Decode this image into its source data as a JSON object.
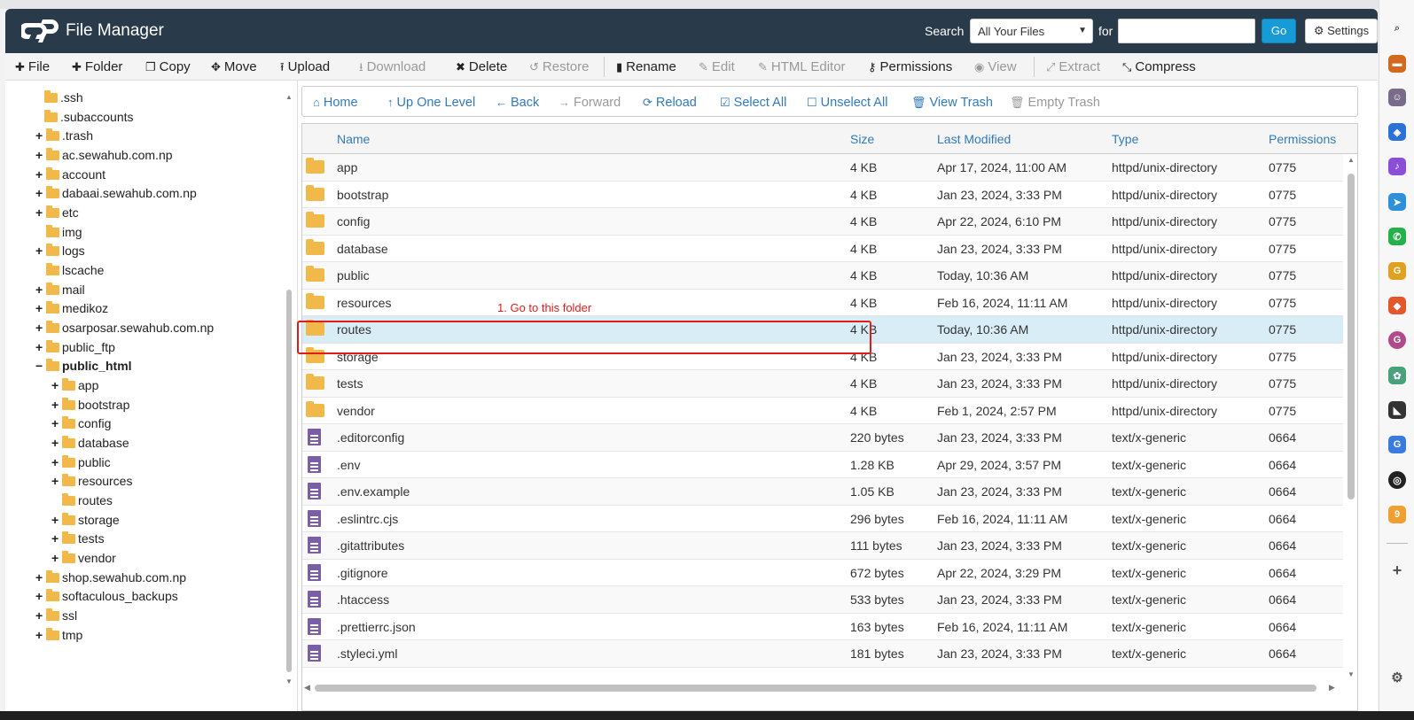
{
  "header": {
    "title": "File Manager",
    "search_label": "Search",
    "search_scope": "All Your Files",
    "for_label": "for",
    "search_value": "",
    "go_label": "Go",
    "settings_label": "Settings"
  },
  "toolbar": {
    "items": [
      {
        "label": "File",
        "icon": "plus-icon",
        "enabled": true
      },
      {
        "label": "Folder",
        "icon": "plus-icon",
        "enabled": true
      },
      {
        "label": "Copy",
        "icon": "copy-icon",
        "enabled": true
      },
      {
        "label": "Move",
        "icon": "move-icon",
        "enabled": true
      },
      {
        "label": "Upload",
        "icon": "upload-icon",
        "enabled": true
      },
      {
        "label": "Download",
        "icon": "download-icon",
        "enabled": false
      },
      {
        "label": "Delete",
        "icon": "x-icon",
        "enabled": true
      },
      {
        "label": "Restore",
        "icon": "restore-icon",
        "enabled": false
      },
      {
        "label": "Rename",
        "icon": "file-icon",
        "enabled": true
      },
      {
        "label": "Edit",
        "icon": "pencil-icon",
        "enabled": false
      },
      {
        "label": "HTML Editor",
        "icon": "edit-icon",
        "enabled": false
      },
      {
        "label": "Permissions",
        "icon": "key-icon",
        "enabled": true
      },
      {
        "label": "View",
        "icon": "eye-icon",
        "enabled": false
      },
      {
        "label": "Extract",
        "icon": "expand-icon",
        "enabled": false
      },
      {
        "label": "Compress",
        "icon": "compress-icon",
        "enabled": true
      }
    ]
  },
  "navbar": {
    "items": [
      {
        "label": "Home",
        "icon": "home-icon",
        "enabled": true
      },
      {
        "label": "Up One Level",
        "icon": "arrow-up-icon",
        "enabled": true
      },
      {
        "label": "Back",
        "icon": "arrow-left-icon",
        "enabled": true
      },
      {
        "label": "Forward",
        "icon": "arrow-right-icon",
        "enabled": false
      },
      {
        "label": "Reload",
        "icon": "refresh-icon",
        "enabled": true
      },
      {
        "label": "Select All",
        "icon": "checkbox-checked-icon",
        "enabled": true
      },
      {
        "label": "Unselect All",
        "icon": "checkbox-empty-icon",
        "enabled": true
      },
      {
        "label": "View Trash",
        "icon": "trash-icon",
        "enabled": true
      },
      {
        "label": "Empty Trash",
        "icon": "trash-icon",
        "enabled": false
      }
    ]
  },
  "tree": {
    "items": [
      {
        "label": ".ssh",
        "expander": ""
      },
      {
        "label": ".subaccounts",
        "expander": ""
      },
      {
        "label": ".trash",
        "expander": "+"
      },
      {
        "label": "ac.sewahub.com.np",
        "expander": "+"
      },
      {
        "label": "account",
        "expander": "+"
      },
      {
        "label": "dabaai.sewahub.com.np",
        "expander": "+"
      },
      {
        "label": "etc",
        "expander": "+"
      },
      {
        "label": "img",
        "expander": ""
      },
      {
        "label": "logs",
        "expander": "+"
      },
      {
        "label": "lscache",
        "expander": ""
      },
      {
        "label": "mail",
        "expander": "+"
      },
      {
        "label": "medikoz",
        "expander": "+"
      },
      {
        "label": "osarposar.sewahub.com.np",
        "expander": "+"
      },
      {
        "label": "public_ftp",
        "expander": "+"
      },
      {
        "label": "public_html",
        "expander": "−"
      },
      {
        "label": "app",
        "expander": "+"
      },
      {
        "label": "bootstrap",
        "expander": "+"
      },
      {
        "label": "config",
        "expander": "+"
      },
      {
        "label": "database",
        "expander": "+"
      },
      {
        "label": "public",
        "expander": "+"
      },
      {
        "label": "resources",
        "expander": "+"
      },
      {
        "label": "routes",
        "expander": ""
      },
      {
        "label": "storage",
        "expander": "+"
      },
      {
        "label": "tests",
        "expander": "+"
      },
      {
        "label": "vendor",
        "expander": "+"
      },
      {
        "label": "shop.sewahub.com.np",
        "expander": "+"
      },
      {
        "label": "softaculous_backups",
        "expander": "+"
      },
      {
        "label": "ssl",
        "expander": "+"
      },
      {
        "label": "tmp",
        "expander": "+"
      }
    ]
  },
  "table": {
    "columns": [
      "Name",
      "Size",
      "Last Modified",
      "Type",
      "Permissions"
    ],
    "rows": [
      {
        "kind": "folder",
        "name": "app",
        "size": "4 KB",
        "modified": "Apr 17, 2024, 11:00 AM",
        "type": "httpd/unix-directory",
        "perms": "0775"
      },
      {
        "kind": "folder",
        "name": "bootstrap",
        "size": "4 KB",
        "modified": "Jan 23, 2024, 3:33 PM",
        "type": "httpd/unix-directory",
        "perms": "0775"
      },
      {
        "kind": "folder",
        "name": "config",
        "size": "4 KB",
        "modified": "Apr 22, 2024, 6:10 PM",
        "type": "httpd/unix-directory",
        "perms": "0775"
      },
      {
        "kind": "folder",
        "name": "database",
        "size": "4 KB",
        "modified": "Jan 23, 2024, 3:33 PM",
        "type": "httpd/unix-directory",
        "perms": "0775"
      },
      {
        "kind": "folder",
        "name": "public",
        "size": "4 KB",
        "modified": "Today, 10:36 AM",
        "type": "httpd/unix-directory",
        "perms": "0775"
      },
      {
        "kind": "folder",
        "name": "resources",
        "size": "4 KB",
        "modified": "Feb 16, 2024, 11:11 AM",
        "type": "httpd/unix-directory",
        "perms": "0775"
      },
      {
        "kind": "folder",
        "name": "routes",
        "size": "4 KB",
        "modified": "Today, 10:36 AM",
        "type": "httpd/unix-directory",
        "perms": "0775",
        "selected": true
      },
      {
        "kind": "folder",
        "name": "storage",
        "size": "4 KB",
        "modified": "Jan 23, 2024, 3:33 PM",
        "type": "httpd/unix-directory",
        "perms": "0775"
      },
      {
        "kind": "folder",
        "name": "tests",
        "size": "4 KB",
        "modified": "Jan 23, 2024, 3:33 PM",
        "type": "httpd/unix-directory",
        "perms": "0775"
      },
      {
        "kind": "folder",
        "name": "vendor",
        "size": "4 KB",
        "modified": "Feb 1, 2024, 2:57 PM",
        "type": "httpd/unix-directory",
        "perms": "0775"
      },
      {
        "kind": "file",
        "name": ".editorconfig",
        "size": "220 bytes",
        "modified": "Jan 23, 2024, 3:33 PM",
        "type": "text/x-generic",
        "perms": "0664"
      },
      {
        "kind": "file",
        "name": ".env",
        "size": "1.28 KB",
        "modified": "Apr 29, 2024, 3:57 PM",
        "type": "text/x-generic",
        "perms": "0664"
      },
      {
        "kind": "file",
        "name": ".env.example",
        "size": "1.05 KB",
        "modified": "Jan 23, 2024, 3:33 PM",
        "type": "text/x-generic",
        "perms": "0664"
      },
      {
        "kind": "file",
        "name": ".eslintrc.cjs",
        "size": "296 bytes",
        "modified": "Feb 16, 2024, 11:11 AM",
        "type": "text/x-generic",
        "perms": "0664"
      },
      {
        "kind": "file",
        "name": ".gitattributes",
        "size": "111 bytes",
        "modified": "Jan 23, 2024, 3:33 PM",
        "type": "text/x-generic",
        "perms": "0664"
      },
      {
        "kind": "file",
        "name": ".gitignore",
        "size": "672 bytes",
        "modified": "Apr 22, 2024, 3:29 PM",
        "type": "text/x-generic",
        "perms": "0664"
      },
      {
        "kind": "file",
        "name": ".htaccess",
        "size": "533 bytes",
        "modified": "Jan 23, 2024, 3:33 PM",
        "type": "text/x-generic",
        "perms": "0664"
      },
      {
        "kind": "file",
        "name": ".prettierrc.json",
        "size": "163 bytes",
        "modified": "Feb 16, 2024, 11:11 AM",
        "type": "text/x-generic",
        "perms": "0664"
      },
      {
        "kind": "file",
        "name": ".styleci.yml",
        "size": "181 bytes",
        "modified": "Jan 23, 2024, 3:33 PM",
        "type": "text/x-generic",
        "perms": "0664"
      }
    ]
  },
  "annotation": {
    "text": "1. Go to this folder",
    "color": "#e21b1b"
  },
  "colors": {
    "header_bg": "#293a4a",
    "link": "#337ab7",
    "go_button": "#179bd7",
    "folder": "#f0b94a",
    "file": "#7a5ea8",
    "selected_row": "#d9edf7"
  }
}
